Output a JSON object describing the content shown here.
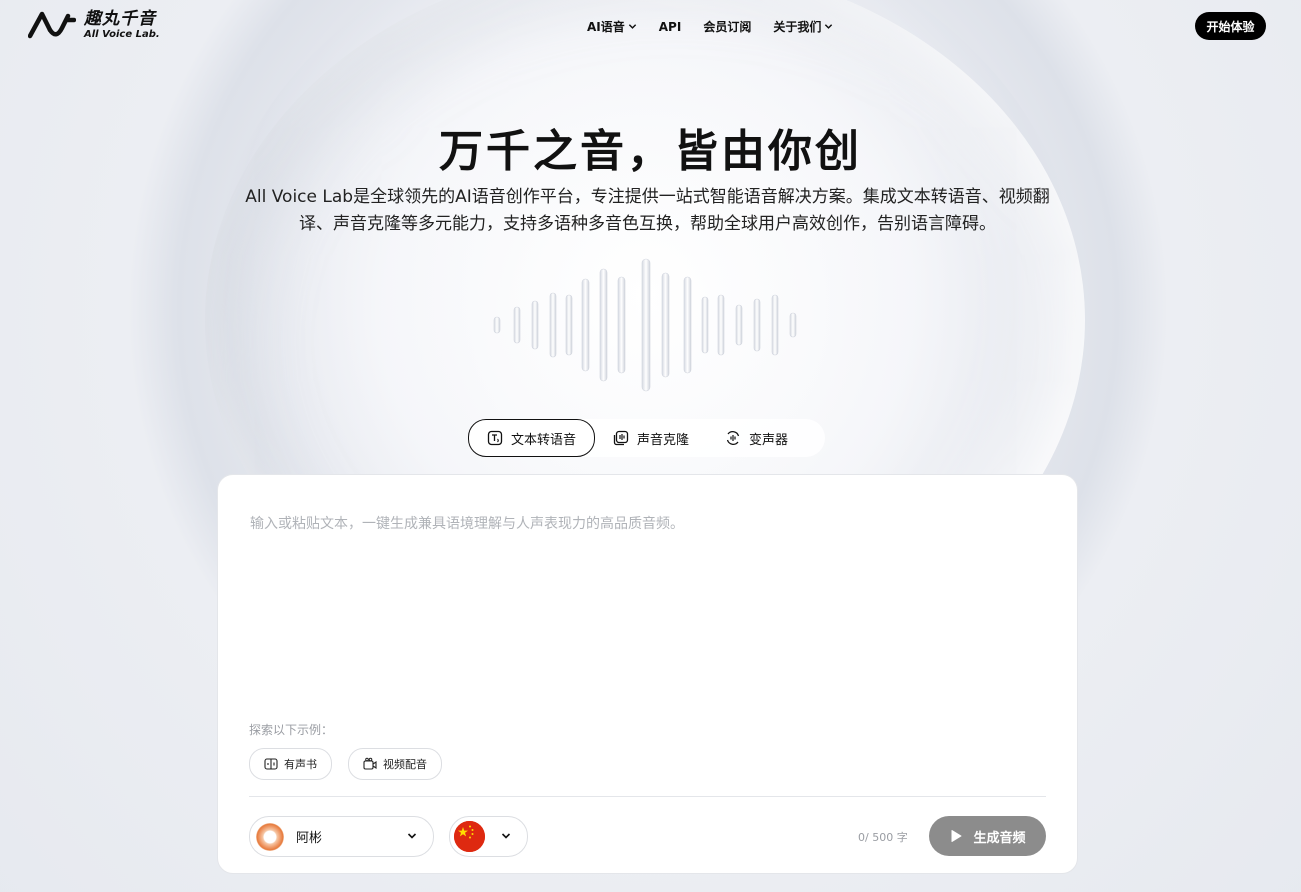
{
  "header": {
    "logo_cn": "趣丸千音",
    "logo_en": "All Voice Lab.",
    "menu": [
      {
        "label": "AI语音",
        "has_dropdown": true
      },
      {
        "label": "API",
        "has_dropdown": false
      },
      {
        "label": "会员订阅",
        "has_dropdown": false
      },
      {
        "label": "关于我们",
        "has_dropdown": true
      }
    ],
    "cta_label": "开始体验"
  },
  "hero": {
    "title": "万千之音，皆由你创",
    "subtitle": "All Voice Lab是全球领先的AI语音创作平台，专注提供一站式智能语音解决方案。集成文本转语音、视频翻译、声音克隆等多元能力，支持多语种多音色互换，帮助全球用户高效创作，告别语言障碍。"
  },
  "tabs": [
    {
      "label": "文本转语音",
      "icon": "text-to-speech-icon",
      "active": true
    },
    {
      "label": "声音克隆",
      "icon": "voice-clone-icon",
      "active": false
    },
    {
      "label": "变声器",
      "icon": "voice-changer-icon",
      "active": false
    }
  ],
  "editor": {
    "placeholder": "输入或粘贴文本，一键生成兼具语境理解与人声表现力的高品质音频。",
    "value": "",
    "explore_label": "探索以下示例：",
    "examples": [
      {
        "label": "有声书",
        "icon": "audiobook-icon"
      },
      {
        "label": "视频配音",
        "icon": "video-dubbing-icon"
      }
    ],
    "voice": {
      "name": "阿彬",
      "icon": "voice-avatar"
    },
    "language": {
      "icon": "china-flag-icon"
    },
    "counter": "0/ 500 字",
    "generate_label": "生成音频"
  },
  "colors": {
    "accent": "#000000",
    "generate_disabled": "#8c8c8c",
    "flag_red": "#de2910",
    "flag_yellow": "#ffde00"
  }
}
